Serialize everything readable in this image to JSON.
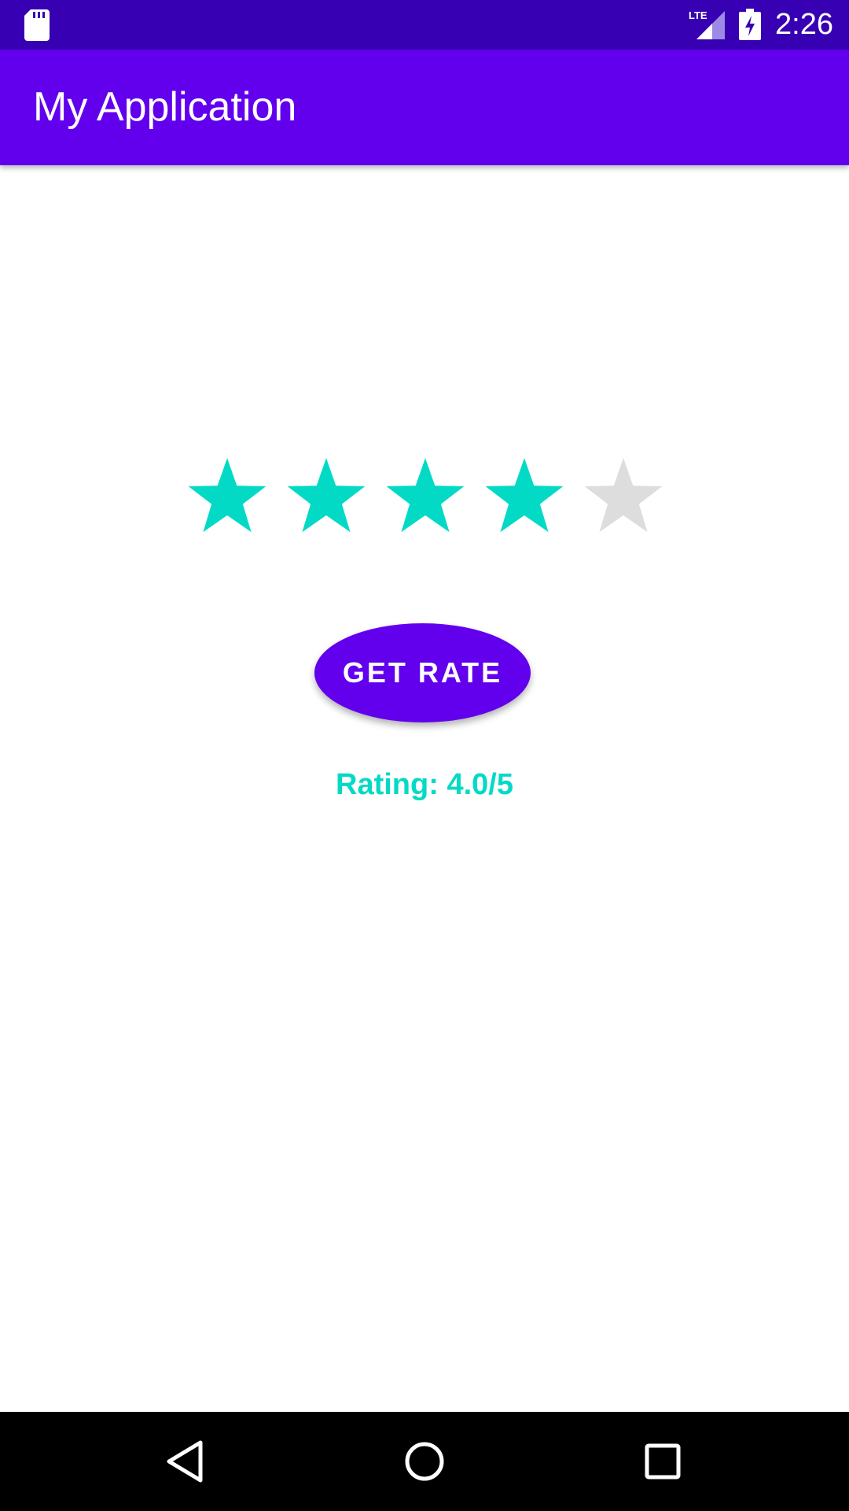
{
  "status_bar": {
    "time": "2:26",
    "network": "LTE",
    "icons": [
      "sd-card-icon",
      "lte-signal-icon",
      "battery-charging-icon"
    ]
  },
  "app_bar": {
    "title": "My Application"
  },
  "rating_bar": {
    "rating": 4.0,
    "max": 5,
    "stars": [
      {
        "filled": true
      },
      {
        "filled": true
      },
      {
        "filled": true
      },
      {
        "filled": true
      },
      {
        "filled": false
      }
    ]
  },
  "button": {
    "label": "GET RATE"
  },
  "result": {
    "text": "Rating: 4.0/5"
  },
  "nav_bar": {
    "icons": [
      "back-icon",
      "home-icon",
      "recents-icon"
    ]
  },
  "colors": {
    "status_bar": "#3700b3",
    "primary": "#6200ee",
    "accent": "#03dac5",
    "star_empty": "#dddddd",
    "nav_bar": "#000000"
  }
}
